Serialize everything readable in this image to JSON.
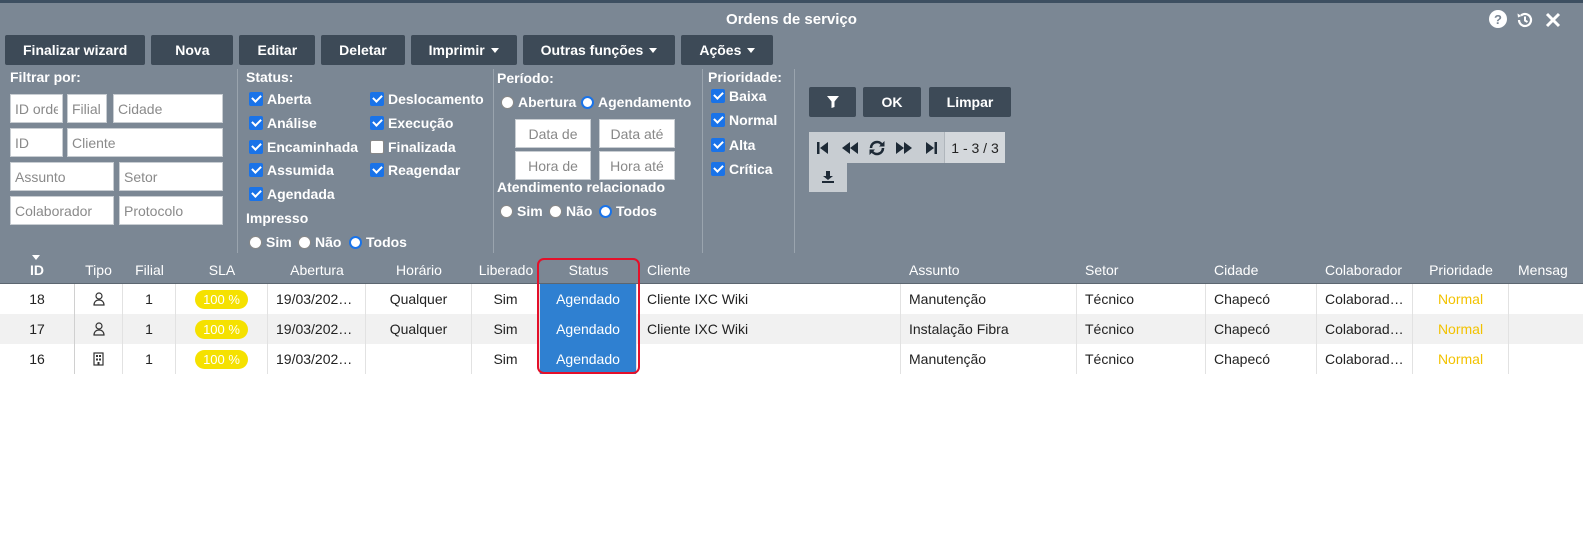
{
  "window": {
    "title": "Ordens de serviço",
    "icons": [
      "help-icon",
      "history-icon",
      "close-icon"
    ]
  },
  "toolbar": {
    "buttons": [
      {
        "label": "Finalizar wizard",
        "dropdown": false
      },
      {
        "label": "Nova",
        "dropdown": false
      },
      {
        "label": "Editar",
        "dropdown": false
      },
      {
        "label": "Deletar",
        "dropdown": false
      },
      {
        "label": "Imprimir",
        "dropdown": true
      },
      {
        "label": "Outras funções",
        "dropdown": true
      },
      {
        "label": "Ações",
        "dropdown": true
      }
    ]
  },
  "filters": {
    "label": "Filtrar por:",
    "placeholders": {
      "id_order": "ID ordem",
      "filial": "Filial",
      "cidade": "Cidade",
      "id": "ID",
      "cliente": "Cliente",
      "assunto": "Assunto",
      "setor": "Setor",
      "colaborador": "Colaborador",
      "protocolo": "Protocolo"
    }
  },
  "status": {
    "label": "Status:",
    "options": [
      {
        "label": "Aberta",
        "checked": true
      },
      {
        "label": "Análise",
        "checked": true
      },
      {
        "label": "Encaminhada",
        "checked": true
      },
      {
        "label": "Assumida",
        "checked": true
      },
      {
        "label": "Agendada",
        "checked": true
      },
      {
        "label": "Deslocamento",
        "checked": true
      },
      {
        "label": "Execução",
        "checked": true
      },
      {
        "label": "Finalizada",
        "checked": false
      },
      {
        "label": "Reagendar",
        "checked": true
      }
    ],
    "impresso_label": "Impresso",
    "impresso": [
      {
        "label": "Sim",
        "selected": false
      },
      {
        "label": "Não",
        "selected": false
      },
      {
        "label": "Todos",
        "selected": true
      }
    ]
  },
  "periodo": {
    "label": "Período:",
    "options": [
      {
        "label": "Abertura",
        "selected": false
      },
      {
        "label": "Agendamento",
        "selected": true
      }
    ],
    "data_de": "Data de",
    "data_ate": "Data até",
    "hora_de": "Hora de",
    "hora_ate": "Hora até",
    "atendimento_label": "Atendimento relacionado",
    "atendimento": [
      {
        "label": "Sim",
        "selected": false
      },
      {
        "label": "Não",
        "selected": false
      },
      {
        "label": "Todos",
        "selected": true
      }
    ]
  },
  "prioridade": {
    "label": "Prioridade:",
    "options": [
      {
        "label": "Baixa",
        "checked": true
      },
      {
        "label": "Normal",
        "checked": true
      },
      {
        "label": "Alta",
        "checked": true
      },
      {
        "label": "Crítica",
        "checked": true
      }
    ]
  },
  "actions": {
    "ok": "OK",
    "limpar": "Limpar",
    "pager_count": "1 - 3 / 3"
  },
  "table": {
    "columns": [
      "ID",
      "Tipo",
      "Filial",
      "SLA",
      "Abertura",
      "Horário",
      "Liberado",
      "Status",
      "Cliente",
      "Assunto",
      "Setor",
      "Cidade",
      "Colaborador",
      "Prioridade",
      "Mensag"
    ],
    "rows": [
      {
        "id": "18",
        "tipo_icon": "user-icon",
        "filial": "1",
        "sla": "100 %",
        "abertura": "19/03/202…",
        "horario": "Qualquer",
        "liberado": "Sim",
        "status": "Agendado",
        "cliente": "Cliente IXC Wiki",
        "assunto": "Manutenção",
        "setor": "Técnico",
        "cidade": "Chapecó",
        "colaborador": "Colaborad…",
        "prioridade": "Normal"
      },
      {
        "id": "17",
        "tipo_icon": "user-icon",
        "filial": "1",
        "sla": "100 %",
        "abertura": "19/03/202…",
        "horario": "Qualquer",
        "liberado": "Sim",
        "status": "Agendado",
        "cliente": "Cliente IXC Wiki",
        "assunto": "Instalação Fibra",
        "setor": "Técnico",
        "cidade": "Chapecó",
        "colaborador": "Colaborad…",
        "prioridade": "Normal"
      },
      {
        "id": "16",
        "tipo_icon": "building-icon",
        "filial": "1",
        "sla": "100 %",
        "abertura": "19/03/202…",
        "horario": "",
        "liberado": "Sim",
        "status": "Agendado",
        "cliente": "",
        "assunto": "Manutenção",
        "setor": "Técnico",
        "cidade": "Chapecó",
        "colaborador": "Colaborad…",
        "prioridade": "Normal"
      }
    ]
  },
  "colors": {
    "header_bg": "#7b8794",
    "button_bg": "#3d4a57",
    "status_bg": "#2f80d1",
    "sla_bg": "#f5e100",
    "priority_normal": "#f2c200",
    "highlight": "#e4102a"
  }
}
